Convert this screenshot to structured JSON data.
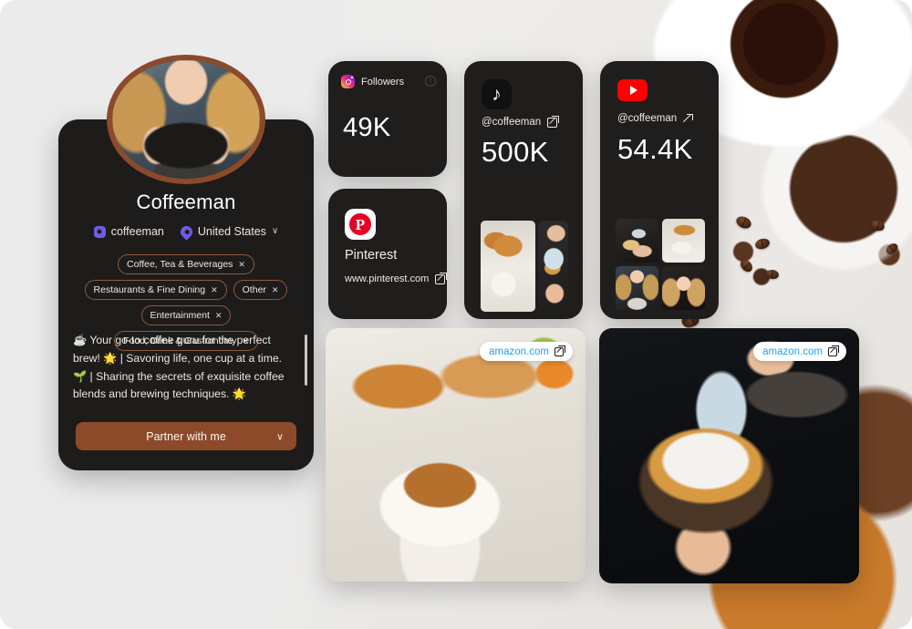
{
  "profile": {
    "name": "Coffeeman",
    "username": "coffeeman",
    "country": "United States",
    "country_chevron": "∨",
    "tags": [
      {
        "label": "Coffee, Tea & Beverages",
        "remove": "✕"
      },
      {
        "label": "Restaurants & Fine Dining",
        "remove": "✕"
      },
      {
        "label": "Other",
        "remove": "✕"
      },
      {
        "label": "Entertainment",
        "remove": "✕"
      },
      {
        "label": "Food, Drink & Gastronomy",
        "remove": "✕"
      }
    ],
    "bio": "☕ Your go-to coffee guru for the perfect brew! 🌟 | Savoring life, one cup at a time. 🌱 | Sharing the secrets of exquisite coffee blends and brewing techniques. 🌟",
    "cta_label": "Partner with me",
    "cta_chevron": "∨",
    "accent_color": "#8d4a2b",
    "icon_color": "#6c5ce7",
    "card_color": "#1e1c1b"
  },
  "social": {
    "instagram": {
      "label": "Followers",
      "value": "49K",
      "info_glyph": "i",
      "icon": "instagram-icon"
    },
    "pinterest": {
      "title": "Pinterest",
      "url": "www.pinterest.com",
      "icon": "pinterest-icon",
      "brand_color": "#e60023",
      "mark": "P"
    },
    "tiktok": {
      "handle": "@coffeeman",
      "value": "500K",
      "icon": "tiktok-icon",
      "note_glyph": "♪"
    },
    "youtube": {
      "handle": "@coffeeman",
      "value": "54.4K",
      "icon": "youtube-icon",
      "brand_color": "#ff0000"
    }
  },
  "promos": [
    {
      "badge": "amazon.com",
      "badge_color": "#1fa2f0"
    },
    {
      "badge": "amazon.com",
      "badge_color": "#1fa2f0"
    }
  ]
}
